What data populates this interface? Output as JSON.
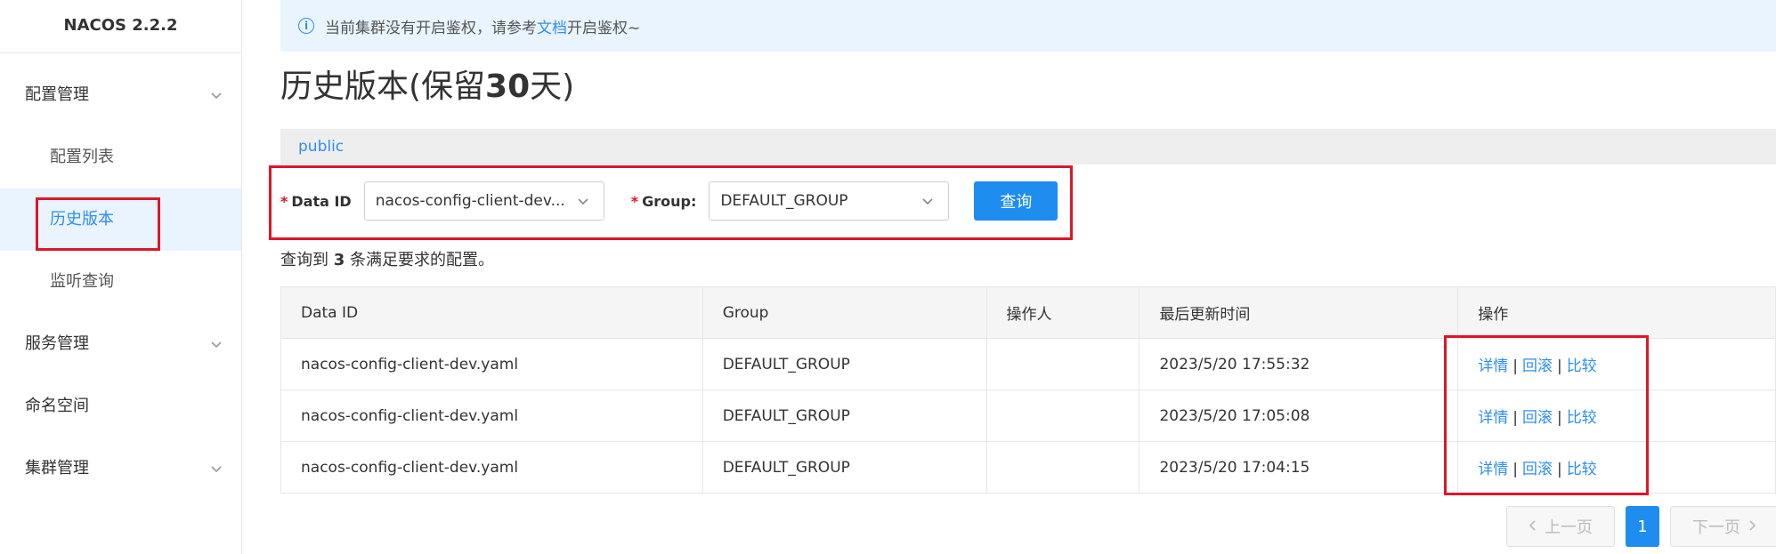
{
  "brand": "NACOS 2.2.2",
  "sidebar": {
    "items": [
      {
        "label": "配置管理"
      },
      {
        "label": "配置列表"
      },
      {
        "label": "历史版本"
      },
      {
        "label": "监听查询"
      },
      {
        "label": "服务管理"
      },
      {
        "label": "命名空间"
      },
      {
        "label": "集群管理"
      }
    ]
  },
  "notice": {
    "prefix": "当前集群没有开启鉴权，请参考",
    "link": "文档",
    "suffix": "开启鉴权~"
  },
  "page": {
    "title_prefix": "历史版本(保留",
    "title_num": "30",
    "title_suffix": "天)"
  },
  "namespace": "public",
  "form": {
    "data_id_label": "Data ID",
    "data_id_value": "nacos-config-client-dev...",
    "group_label": "Group:",
    "group_value": "DEFAULT_GROUP",
    "query_button": "查询",
    "required_mark": "*"
  },
  "result": {
    "prefix": "查询到",
    "count": "3",
    "suffix": "条满足要求的配置。"
  },
  "table": {
    "headers": [
      "Data ID",
      "Group",
      "操作人",
      "最后更新时间",
      "操作"
    ],
    "rows": [
      {
        "data_id": "nacos-config-client-dev.yaml",
        "group": "DEFAULT_GROUP",
        "operator": "",
        "time": "2023/5/20 17:55:32"
      },
      {
        "data_id": "nacos-config-client-dev.yaml",
        "group": "DEFAULT_GROUP",
        "operator": "",
        "time": "2023/5/20 17:05:08"
      },
      {
        "data_id": "nacos-config-client-dev.yaml",
        "group": "DEFAULT_GROUP",
        "operator": "",
        "time": "2023/5/20 17:04:15"
      }
    ],
    "actions": {
      "detail": "详情",
      "rollback": "回滚",
      "compare": "比较",
      "separator": "|"
    }
  },
  "pager": {
    "prev": "上一页",
    "current": "1",
    "next": "下一页"
  },
  "colors": {
    "accent": "#1f8cf0",
    "highlight": "#e0152a",
    "notice_bg": "#e9f4fe"
  }
}
